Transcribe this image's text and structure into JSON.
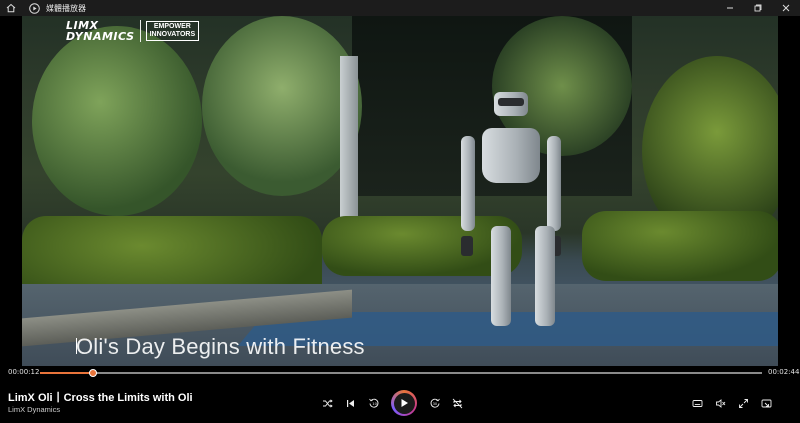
{
  "window": {
    "title": "媒體播放器"
  },
  "video": {
    "logo_brand_line1": "LIMX",
    "logo_brand_line2": "DYNAMICS",
    "logo_tagline_line1": "EMPOWER",
    "logo_tagline_line2": "INNOVATORS",
    "caption": "Oli's Day Begins with Fitness"
  },
  "player": {
    "current_time": "00:00:12",
    "total_time": "00:02:44",
    "progress_fraction": 0.073,
    "accent_color": "#e8743b",
    "title": "LimX Oli丨Cross the Limits with Oli",
    "subtitle": "LimX Dynamics"
  },
  "icons": {
    "home": "home-icon",
    "app": "media-player-icon",
    "minimize": "minimize-icon",
    "restore": "restore-icon",
    "close": "close-icon",
    "shuffle": "shuffle-icon",
    "previous": "previous-icon",
    "rewind": "rewind-10-icon",
    "play": "play-icon",
    "forward": "forward-30-icon",
    "repeat": "repeat-off-icon",
    "subtitles": "subtitles-icon",
    "volume": "volume-mute-icon",
    "fullscreen": "fullscreen-icon",
    "miniplayer": "mini-player-icon"
  }
}
